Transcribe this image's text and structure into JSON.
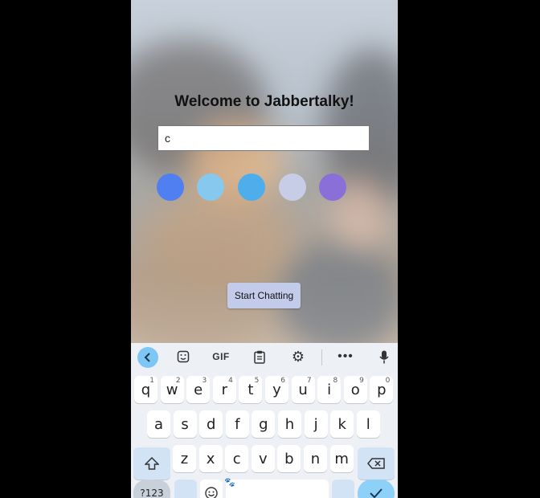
{
  "app": {
    "title": "Welcome to Jabbertalky!",
    "name_input": {
      "value": "c",
      "placeholder": ""
    },
    "color_options": [
      {
        "name": "blue",
        "color": "#4f7ff0"
      },
      {
        "name": "light-blue",
        "color": "#86c8ee"
      },
      {
        "name": "sky-blue",
        "color": "#4eaeeb"
      },
      {
        "name": "lavender",
        "color": "#c7cde7"
      },
      {
        "name": "purple",
        "color": "#8a6fd8"
      }
    ],
    "start_button": "Start Chatting"
  },
  "keyboard": {
    "toolbar": {
      "back_icon": "chevron-left-icon",
      "sticker_icon": "sticker-icon",
      "gif_label": "GIF",
      "clipboard_icon": "clipboard-icon",
      "settings_icon": "gear-icon",
      "more_icon": "more-icon",
      "mic_icon": "microphone-icon"
    },
    "row1": [
      {
        "k": "q",
        "h": "1"
      },
      {
        "k": "w",
        "h": "2"
      },
      {
        "k": "e",
        "h": "3"
      },
      {
        "k": "r",
        "h": "4"
      },
      {
        "k": "t",
        "h": "5"
      },
      {
        "k": "y",
        "h": "6"
      },
      {
        "k": "u",
        "h": "7"
      },
      {
        "k": "i",
        "h": "8"
      },
      {
        "k": "o",
        "h": "9"
      },
      {
        "k": "p",
        "h": "0"
      }
    ],
    "row2": [
      "a",
      "s",
      "d",
      "f",
      "g",
      "h",
      "j",
      "k",
      "l"
    ],
    "row3": [
      "z",
      "x",
      "c",
      "v",
      "b",
      "n",
      "m"
    ],
    "sym_label": "?123",
    "accent": "#8dd0f8"
  }
}
